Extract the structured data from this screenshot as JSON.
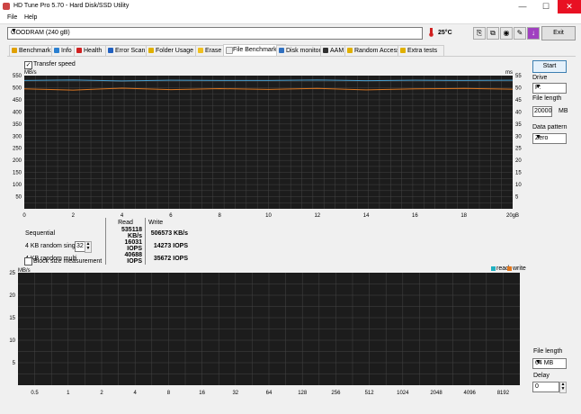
{
  "window": {
    "title": "HD Tune Pro 5.70 - Hard Disk/SSD Utility",
    "minimize": "—",
    "maximize": "☐",
    "close": "✕"
  },
  "menu": {
    "file": "File",
    "help": "Help"
  },
  "toolbar": {
    "drive": "GOODRAM (240 gB)",
    "temperature": "25°C",
    "exit_label": "Exit"
  },
  "tabs": [
    {
      "label": "Benchmark",
      "icon": "benchmark-icon",
      "color": "#e0a000"
    },
    {
      "label": "Info",
      "icon": "info-icon",
      "color": "#2a7fd0"
    },
    {
      "label": "Health",
      "icon": "health-icon",
      "color": "#d02020"
    },
    {
      "label": "Error Scan",
      "icon": "error-scan-icon",
      "color": "#2060c0"
    },
    {
      "label": "Folder Usage",
      "icon": "folder-icon",
      "color": "#e0b000"
    },
    {
      "label": "Erase",
      "icon": "erase-icon",
      "color": "#f0c020"
    },
    {
      "label": "File Benchmark",
      "icon": "file-benchmark-icon",
      "color": "#eeeeee"
    },
    {
      "label": "Disk monitor",
      "icon": "disk-monitor-icon",
      "color": "#3070c0"
    },
    {
      "label": "AAM",
      "icon": "speaker-icon",
      "color": "#303030"
    },
    {
      "label": "Random Access",
      "icon": "random-access-icon",
      "color": "#e0b000"
    },
    {
      "label": "Extra tests",
      "icon": "extra-tests-icon",
      "color": "#e0b000"
    }
  ],
  "transfer": {
    "checkbox_label": "Transfer speed",
    "checked": "✓"
  },
  "right_panel": {
    "start": "Start",
    "drive_label": "Drive",
    "drive_value": "P:",
    "file_length_label": "File length",
    "file_length_value": "20000",
    "file_length_unit": "MB",
    "pattern_label": "Data pattern",
    "pattern_value": "Zero",
    "bottom_file_length_label": "File length",
    "bottom_file_length_value": "64 MB",
    "delay_label": "Delay",
    "delay_value": "0"
  },
  "results": {
    "header_read": "Read",
    "header_write": "Write",
    "rows": [
      {
        "label": "Sequential",
        "read": "535118 KB/s",
        "write": "506573 KB/s"
      },
      {
        "label": "4 KB random single",
        "read": "16031 IOPS",
        "write": "14273 IOPS"
      },
      {
        "label": "4 KB random multi",
        "read": "40688 IOPS",
        "write": "35672 IOPS"
      }
    ],
    "multi_queue": "32"
  },
  "block": {
    "checkbox_label": "Block size measurement",
    "legend_read": "read",
    "legend_write": "write"
  },
  "chart_data": [
    {
      "type": "line",
      "ylabel": "MB/s",
      "y2label": "ms",
      "x": [
        0,
        2,
        4,
        6,
        8,
        10,
        12,
        14,
        16,
        18,
        20
      ],
      "x_tick_labels": [
        "0",
        "2",
        "4",
        "6",
        "8",
        "10",
        "12",
        "14",
        "16",
        "18",
        "20gB"
      ],
      "ylim": [
        0,
        550
      ],
      "y_ticks": [
        50,
        100,
        150,
        200,
        250,
        300,
        350,
        400,
        450,
        500,
        550
      ],
      "y2lim": [
        0,
        55
      ],
      "y2_ticks": [
        5,
        10,
        15,
        20,
        25,
        30,
        35,
        40,
        45,
        50,
        55
      ],
      "grid": true,
      "series": [
        {
          "color": "#4aa0d0",
          "values": [
            530,
            532,
            528,
            531,
            530,
            530,
            532,
            529,
            531,
            530,
            531
          ]
        },
        {
          "color": "#e07820",
          "values": [
            495,
            490,
            498,
            492,
            496,
            493,
            497,
            491,
            495,
            497,
            494
          ]
        }
      ]
    },
    {
      "type": "bar",
      "ylabel": "MB/s",
      "ylim": [
        0,
        25
      ],
      "y_ticks": [
        5,
        10,
        15,
        20,
        25
      ],
      "categories": [
        "0.5",
        "1",
        "2",
        "4",
        "8",
        "16",
        "32",
        "64",
        "128",
        "256",
        "512",
        "1024",
        "2048",
        "4096",
        "8192"
      ],
      "grid": true,
      "series": [
        {
          "name": "read",
          "color": "#20b0c0",
          "values": []
        },
        {
          "name": "write",
          "color": "#e07820",
          "values": []
        }
      ]
    }
  ]
}
